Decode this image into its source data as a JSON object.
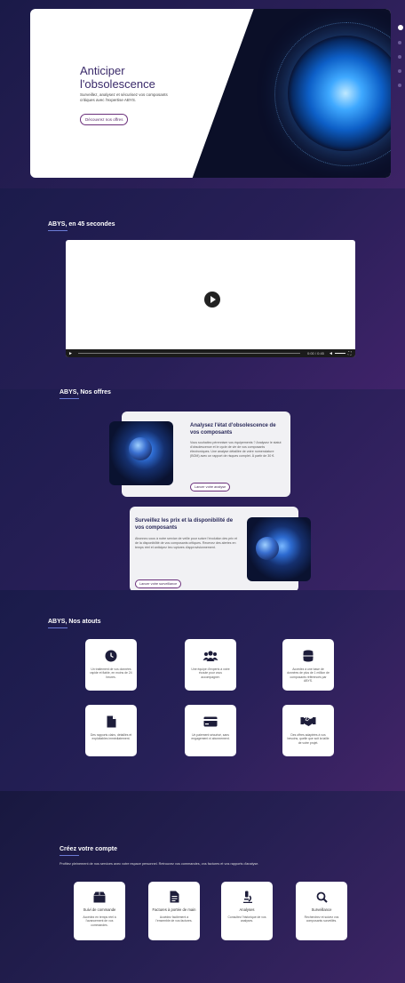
{
  "hero": {
    "title": "Anticiper l'obsolescence",
    "text": "Surveillez, analysez et sécurisez vos composants critiques avec l'expertise ABYS.",
    "button": "Découvrez nos offres"
  },
  "video_section": {
    "title": "ABYS, en 45 secondes",
    "time": "0:00 / 0:45"
  },
  "offers_section": {
    "title": "ABYS, Nos offres",
    "offer1": {
      "title": "Analysez l'état d'obsolescence de vos composants",
      "text": "Vous souhaitez pérenniser vos équipements ? Analysez le statut d'obsolescence et le cycle de vie de vos composants électroniques. Une analyse détaillée de votre nomenclature (BOM) avec un rapport de risques complet. À partir de 30 €.",
      "button": "Lancer votre analyse"
    },
    "offer2": {
      "title": "Surveillez les prix et la disponibilité de vos composants",
      "text": "Abonnez-vous à notre service de veille pour suivre l'évolution des prix et de la disponibilité de vos composants critiques. Recevez des alertes en temps réel et anticipez les ruptures d'approvisionnement.",
      "button": "Lancer votre surveillance"
    }
  },
  "atouts_section": {
    "title": "ABYS, Nos atouts",
    "cards": [
      {
        "icon": "clock-icon",
        "text": "Un traitement de vos données rapide et fiable, en moins de 24 heures."
      },
      {
        "icon": "users-icon",
        "text": "Une équipe d'experts à votre écoute pour vous accompagner."
      },
      {
        "icon": "database-icon",
        "text": "Accédez à une base de données de plus de 1 million de composants référencés par ABYS."
      },
      {
        "icon": "file-icon",
        "text": "Des rapports clairs, détaillés et exploitables immédiatement."
      },
      {
        "icon": "credit-card-icon",
        "text": "Un paiement sécurisé, sans engagement ni abonnement."
      },
      {
        "icon": "handshake-icon",
        "text": "Des offres adaptées à vos besoins, quelle que soit la taille de votre projet."
      }
    ]
  },
  "account_section": {
    "title": "Créez votre compte",
    "text": "Profitez pleinement de nos services avec votre espace personnel. Retrouvez vos commandes, vos factures et vos rapports d'analyse.",
    "cards": [
      {
        "icon": "box-icon",
        "title": "Suivi de commande",
        "text": "Accédez en temps réel à l'avancement de vos commandes."
      },
      {
        "icon": "document-icon",
        "title": "Factures à portée de main",
        "text": "Accédez facilement à l'ensemble de vos factures."
      },
      {
        "icon": "microscope-icon",
        "title": "Analyses",
        "text": "Consultez l'historique de vos analyses."
      },
      {
        "icon": "search-icon",
        "title": "Surveillance",
        "text": "Recherchez et suivez vos composants surveillés."
      }
    ]
  },
  "colors": {
    "accent": "#6b7bd6",
    "brand": "#6a2f7a",
    "background": "#1c1b4a"
  }
}
